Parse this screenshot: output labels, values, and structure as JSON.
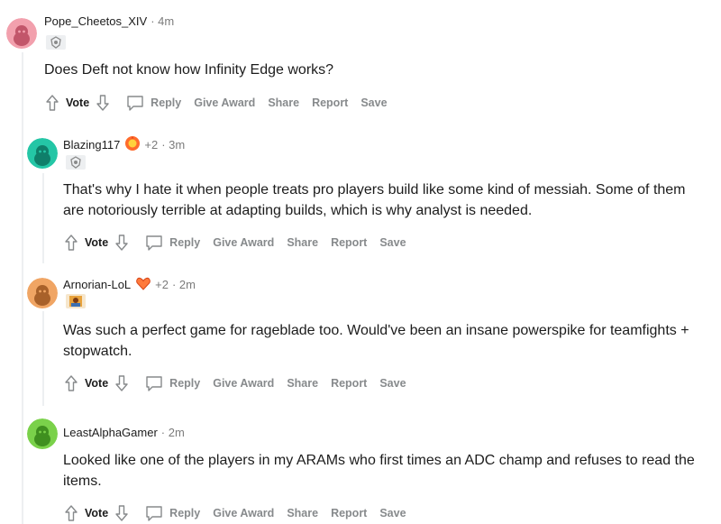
{
  "colors": {
    "thread_line": "#edeff1",
    "meta_gray": "#7c7c7c",
    "action_gray": "#878a8c",
    "text": "#1c1c1c"
  },
  "comments": [
    {
      "username": "Pope_Cheetos_XIV",
      "score_badge": "",
      "time": "· 4m",
      "avatar_color": "#f2a0ad",
      "flair_icon": "league-crest-icon",
      "body": "Does Deft not know how Infinity Edge works?",
      "actions": {
        "vote": "Vote",
        "reply": "Reply",
        "give_award": "Give Award",
        "share": "Share",
        "report": "Report",
        "save": "Save"
      }
    },
    {
      "username": "Blazing117",
      "score_badge": "+2",
      "time": "· 3m",
      "avatar_color": "#24c6a6",
      "flair_icon": "league-crest-icon",
      "body": "That's why I hate it when people treats pro players build like some kind of messiah. Some of them are notoriously terrible at adapting builds, which is why analyst is needed.",
      "actions": {
        "vote": "Vote",
        "reply": "Reply",
        "give_award": "Give Award",
        "share": "Share",
        "report": "Report",
        "save": "Save"
      }
    },
    {
      "username": "Arnorian-LoL",
      "score_badge": "+2",
      "time": "· 2m",
      "avatar_color": "#f0a564",
      "flair_icon": "champion-portrait-icon",
      "body": "Was such a perfect game for rageblade too. Would've been an insane powerspike for teamfights + stopwatch.",
      "actions": {
        "vote": "Vote",
        "reply": "Reply",
        "give_award": "Give Award",
        "share": "Share",
        "report": "Report",
        "save": "Save"
      }
    },
    {
      "username": "LeastAlphaGamer",
      "score_badge": "",
      "time": "· 2m",
      "avatar_color": "#7ad14a",
      "flair_icon": "",
      "body": "Looked like one of the players in my ARAMs who first times an ADC champ and refuses to read the items.",
      "actions": {
        "vote": "Vote",
        "reply": "Reply",
        "give_award": "Give Award",
        "share": "Share",
        "report": "Report",
        "save": "Save"
      }
    }
  ]
}
